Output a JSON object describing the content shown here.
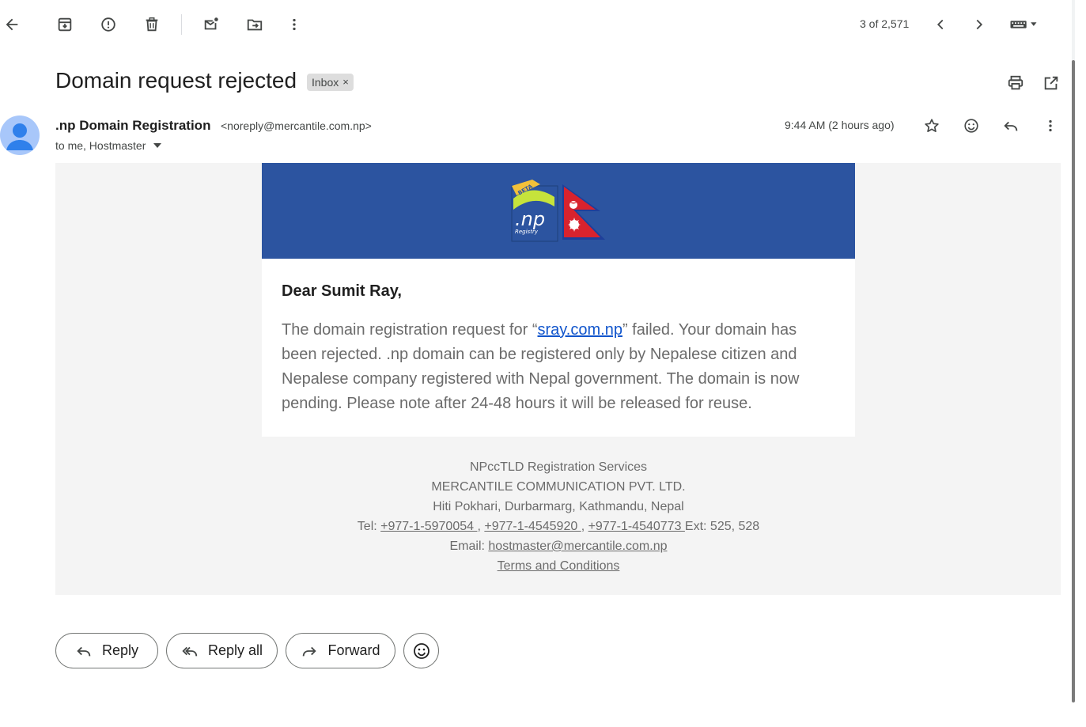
{
  "toolbar": {
    "icons": [
      "back-arrow-icon",
      "archive-icon",
      "report-spam-icon",
      "delete-icon",
      "mark-unread-icon",
      "move-to-icon",
      "more-vert-icon"
    ],
    "count": "3 of 2,571"
  },
  "subject": {
    "title": "Domain request rejected",
    "label": "Inbox",
    "label_close": "×"
  },
  "sender": {
    "name": ".np Domain Registration",
    "email": "<noreply@mercantile.com.np>",
    "recipients": "to me, Hostmaster",
    "timestamp": "9:44 AM (2 hours ago)"
  },
  "email": {
    "brand_color": "#2c54a0",
    "logo_beta": "BETA",
    "logo_text": ".np",
    "logo_sub": "Registry",
    "greeting": "Dear Sumit Ray,",
    "para_before": "The domain registration request for “",
    "para_link": "sray.com.np",
    "para_after": "” failed. Your domain has been rejected. .np domain can be registered only by Nepalese citizen and Nepalese company registered with Nepal government. The domain is now pending. Please note after 24-48 hours it will be released for reuse.",
    "footer": {
      "line1": "NPccTLD Registration Services",
      "line2": "MERCANTILE COMMUNICATION PVT. LTD.",
      "line3": "Hiti Pokhari, Durbarmarg, Kathmandu, Nepal",
      "tel_label": "Tel: ",
      "tel1": "+977-1-5970054 ",
      "sep1": ", ",
      "tel2": "+977-1-4545920 ",
      "sep2": ", ",
      "tel3": "+977-1-4540773 ",
      "ext": "Ext: 525, 528",
      "email_label": "Email: ",
      "email": "hostmaster@mercantile.com.np",
      "terms": "Terms and Conditions"
    }
  },
  "actions": {
    "reply": "Reply",
    "reply_all": "Reply all",
    "forward": "Forward"
  }
}
